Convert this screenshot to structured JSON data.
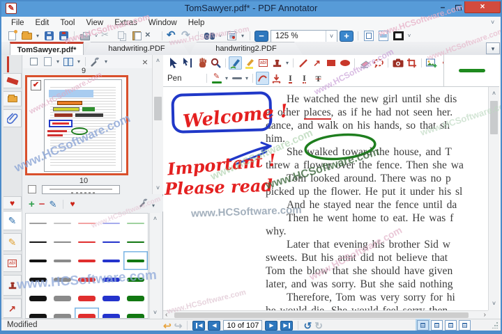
{
  "window": {
    "title": "TomSawyer.pdf* - PDF Annotator",
    "minimize": "–"
  },
  "menu": {
    "items": [
      "File",
      "Edit",
      "Tool",
      "View",
      "Extras",
      "Window",
      "Help"
    ]
  },
  "toolbar": {
    "zoom_value": "125 %"
  },
  "tabs": {
    "tab1": "TomSawyer.pdf*",
    "tab2": "handwriting.PDF",
    "tab3": "handwriting2.PDF"
  },
  "sidebar": {
    "page9_label": "9",
    "page10_label": "10"
  },
  "annotation_toolbar": {
    "tool_label": "Pen"
  },
  "document": {
    "lines": [
      {
        "t": "He watched the new girl until she dis",
        "indent": true
      },
      {
        "pre": "at other ",
        "word": "places",
        "post": ", as if he had not seen her. ",
        "indent": false
      },
      {
        "t": "dance, and walk on his hands, so that sh",
        "indent": false
      },
      {
        "t": "him.",
        "indent": false
      },
      {
        "t": "She walked toward the house, and T",
        "indent": true
      },
      {
        "t": "threw a flower over the fence. Then she wa",
        "indent": false
      },
      {
        "t": "Tom looked around. There was no p",
        "indent": true
      },
      {
        "t": "picked up the flower. He put it under his sl",
        "indent": false
      },
      {
        "t": "And he stayed near the fence until da",
        "indent": true
      },
      {
        "t": "Then he went home to eat. He was f",
        "indent": true
      },
      {
        "t": "why.",
        "indent": false
      },
      {
        "t": "Later that evening his brother Sid w",
        "indent": true
      },
      {
        "t": "sweets. But his aunt did not believe that",
        "indent": false
      },
      {
        "t": "Tom the blow that she should have given",
        "indent": false
      },
      {
        "t": "later, and was sorry. But she said nothing",
        "indent": false
      },
      {
        "t": "Therefore, Tom was very sorry for hi",
        "indent": true
      },
      {
        "t": "he would die. She would feel sorry then",
        "indent": false
      }
    ]
  },
  "ink": {
    "welcome": "Welcome !",
    "important": "Important !",
    "please_read": "Please read"
  },
  "palette": {
    "column_colors": [
      "#141414",
      "#8a8a8a",
      "#e02e2e",
      "#2433cc",
      "#127812"
    ],
    "row1_light_colors": [
      "#9f9f9f",
      "#c4c4c4",
      "#f2a2a2",
      "#a6aced",
      "#9fd29f"
    ],
    "row_thicknesses": [
      2,
      2,
      4,
      6,
      8,
      9
    ],
    "selected_cells": [
      [
        2,
        4
      ],
      [
        5,
        2
      ]
    ]
  },
  "statusbar": {
    "modified": "Modified",
    "page_nav": "10 of 107"
  },
  "watermark": {
    "text": "www.HCSoftware.com"
  },
  "icons": {
    "caret": "▾",
    "chevron_down": "˅",
    "chevron_up": "˄",
    "chevron_left": "‹",
    "chevron_right": "›",
    "scissors": "✂",
    "undo": "↶",
    "redo": "↷",
    "close_x": "×",
    "heart": "♥",
    "plus": "+",
    "minus": "−",
    "check": "✔",
    "pencil": "✎",
    "arrow_ne": "↗",
    "back_arrow": "↩",
    "forward_arrow": "↪",
    "rotate_left": "↺",
    "rotate_right": "↻",
    "prev": "◀",
    "next": "▶",
    "abl": "abl",
    "letter_I": "I",
    "letter_T": "T",
    "app_glyph": "✎"
  }
}
